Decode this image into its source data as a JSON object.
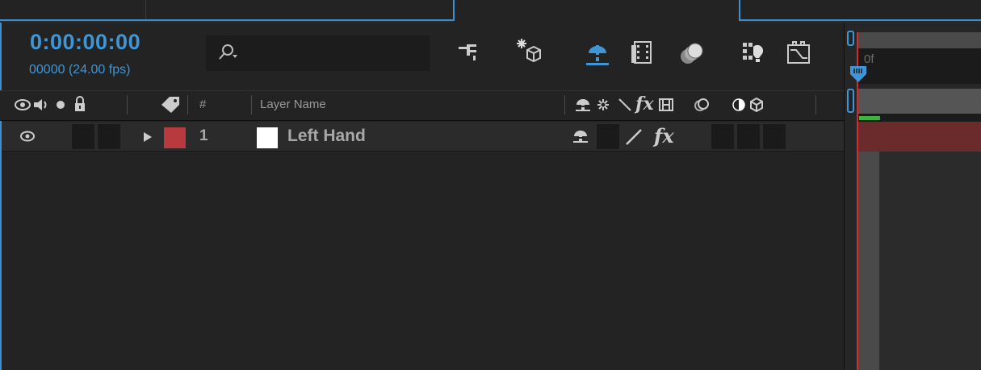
{
  "composition": {
    "timecode": "0:00:00:00",
    "frame_info": "00000 (24.00 fps)"
  },
  "search": {
    "value": "",
    "icon": "search-dropdown-icon"
  },
  "toolbar": {
    "icons": [
      "composition-flowchart-icon",
      "draft-3d-icon",
      "hide-shy-layers-icon",
      "frame-blending-icon",
      "motion-blur-icon",
      "graph-editor-icon",
      "brainstorm-icon"
    ]
  },
  "columns": {
    "switch_icons": [
      "eye-icon",
      "audio-icon",
      "solo-icon",
      "lock-icon"
    ],
    "label_icon": "label-tag-icon",
    "number_header": "#",
    "layer_name_header": "Layer Name",
    "switches_icons": [
      "shy-icon",
      "collapse-icon",
      "quality-icon",
      "effects-icon",
      "frame-blend-icon",
      "motion-blur-icon",
      "adjustment-layer-icon",
      "3d-layer-icon"
    ],
    "fx_label": "fx"
  },
  "layers": [
    {
      "number": "1",
      "name": "Left Hand",
      "label_color": "#b93a3e",
      "swatch_color": "#ffffff",
      "visible": true,
      "fx_label": "fx"
    }
  ],
  "timeline": {
    "ruler_label": "0f"
  },
  "colors": {
    "accent": "#3f95d6",
    "playhead": "#d22c2c",
    "layer_bar": "#6b2a2c",
    "work_area_marker": "#3fb33f"
  }
}
